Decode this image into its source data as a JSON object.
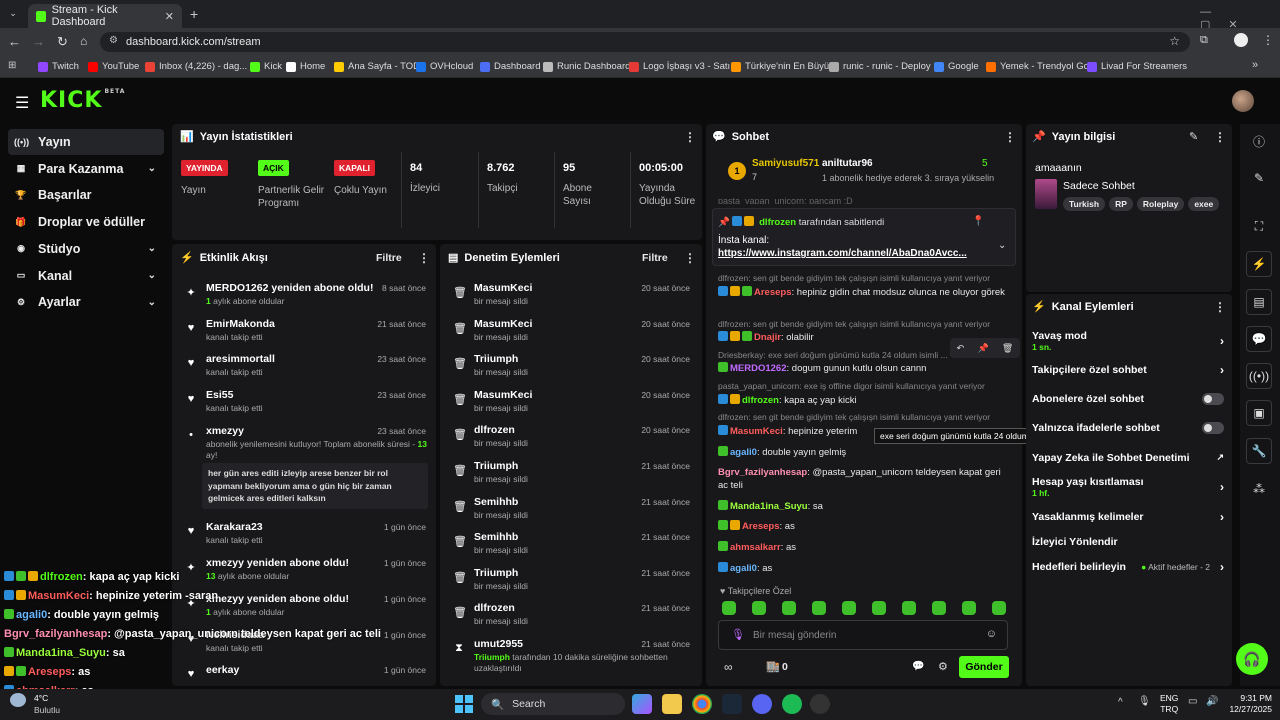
{
  "browser": {
    "tab_title": "Stream - Kick Dashboard",
    "url": "dashboard.kick.com/stream",
    "bookmarks": [
      {
        "label": "Twitch",
        "color": "#9146ff"
      },
      {
        "label": "YouTube",
        "color": "#ff0000"
      },
      {
        "label": "Inbox (4,226) - dag...",
        "color": "#ea4335"
      },
      {
        "label": "Kick",
        "color": "#53fc18"
      },
      {
        "label": "Home",
        "color": "#ffffff"
      },
      {
        "label": "Ana Sayfa - TOD",
        "color": "#ffcc00"
      },
      {
        "label": "OVHcloud",
        "color": "#1a73e8"
      },
      {
        "label": "Dashboard",
        "color": "#4c6ef5"
      },
      {
        "label": "Runic Dashboard",
        "color": "#bbbbbb"
      },
      {
        "label": "Logo İşbaşı v3 - Satı...",
        "color": "#e53935"
      },
      {
        "label": "Türkiye'nin En Büyü...",
        "color": "#ff9800"
      },
      {
        "label": "runic - runic - Deploy",
        "color": "#aaaaaa"
      },
      {
        "label": "Google",
        "color": "#4285f4"
      },
      {
        "label": "Yemek - Trendyol Go",
        "color": "#ff6f00"
      },
      {
        "label": "Livad For Streamers",
        "color": "#7c4dff"
      }
    ]
  },
  "sidebar": {
    "items": [
      {
        "label": "Yayın",
        "icon": "broadcast-icon"
      },
      {
        "label": "Para Kazanma",
        "icon": "money-icon"
      },
      {
        "label": "Başarılar",
        "icon": "trophy-icon"
      },
      {
        "label": "Droplar ve ödüller",
        "icon": "gift-icon"
      },
      {
        "label": "Stüdyo",
        "icon": "studio-icon"
      },
      {
        "label": "Kanal",
        "icon": "channel-icon"
      },
      {
        "label": "Ayarlar",
        "icon": "gear-icon"
      }
    ]
  },
  "stats": {
    "title": "Yayın İstatistikleri",
    "yayin_badge": "YAYINDA",
    "yayin_label": "Yayın",
    "partner_badge": "AÇIK",
    "partner_label": "Partnerlik Gelir Programı",
    "multi_badge": "KAPALI",
    "multi_label": "Çoklu Yayın",
    "viewers": "84",
    "viewers_label": "İzleyici",
    "followers": "8.762",
    "followers_label": "Takipçi",
    "subs": "95",
    "subs_label": "Abone Sayısı",
    "uptime": "00:05:00",
    "uptime_label": "Yayında Olduğu Süre"
  },
  "events": {
    "title": "Etkinlik Akışı",
    "filter": "Filtre",
    "items": [
      {
        "name": "MERDO1262 yeniden abone oldu!",
        "time": "8 saat önce",
        "sub_num": "1",
        "sub": " aylık abone oldular"
      },
      {
        "name": "EmirMakonda",
        "time": "21 saat önce",
        "sub": "kanalı takip etti"
      },
      {
        "name": "aresimmortall",
        "time": "23 saat önce",
        "sub": "kanalı takip etti"
      },
      {
        "name": "Esi55",
        "time": "23 saat önce",
        "sub": "kanalı takip etti"
      },
      {
        "name": "xmezyy",
        "time": "23 saat önce",
        "sub": "abonelik yenilemesini kutluyor! Toplam abonelik süresi - ",
        "sub_num": "13",
        "sub2": "ay!",
        "message": "her gün ares editi izleyip arese benzer bir rol yapmanı bekliyorum ama o gün hiç bir zaman gelmicek ares editleri kalksın"
      },
      {
        "name": "Karakara23",
        "time": "1 gün önce",
        "sub": "kanalı takip etti"
      },
      {
        "name": "xmezyy yeniden abone oldu!",
        "time": "1 gün önce",
        "sub_num": "13",
        "sub": " aylık abone oldular"
      },
      {
        "name": "xmezyy yeniden abone oldu!",
        "time": "1 gün önce",
        "sub_num": "1",
        "sub": " aylık abone oldular"
      },
      {
        "name": "Nelinsidaaa",
        "time": "1 gün önce",
        "sub": "kanalı takip etti"
      },
      {
        "name": "eerkay",
        "time": "1 gün önce",
        "sub": ""
      }
    ]
  },
  "mod": {
    "title": "Denetim Eylemleri",
    "filter": "Filtre",
    "items": [
      {
        "name": "MasumKeci",
        "time": "20 saat önce",
        "sub": "bir mesajı sildi"
      },
      {
        "name": "MasumKeci",
        "time": "20 saat önce",
        "sub": "bir mesajı sildi"
      },
      {
        "name": "Triiumph",
        "time": "20 saat önce",
        "sub": "bir mesajı sildi"
      },
      {
        "name": "MasumKeci",
        "time": "20 saat önce",
        "sub": "bir mesajı sildi"
      },
      {
        "name": "dlfrozen",
        "time": "20 saat önce",
        "sub": "bir mesajı sildi"
      },
      {
        "name": "Triiumph",
        "time": "21 saat önce",
        "sub": "bir mesajı sildi"
      },
      {
        "name": "Semihhb",
        "time": "21 saat önce",
        "sub": "bir mesajı sildi"
      },
      {
        "name": "Semihhb",
        "time": "21 saat önce",
        "sub": "bir mesajı sildi"
      },
      {
        "name": "Triiumph",
        "time": "21 saat önce",
        "sub": "bir mesajı sildi"
      },
      {
        "name": "dlfrozen",
        "time": "21 saat önce",
        "sub": "bir mesajı sildi"
      },
      {
        "name": "umut2955",
        "time": "21 saat önce",
        "sub_user": "Triiumph",
        "sub": " tarafından 10 dakika süreliğine sohbetten uzaklaştırıldı"
      }
    ]
  },
  "chat": {
    "title": "Sohbet",
    "gifter": "Samiyusuf571",
    "gift_count": "7",
    "gift_target": "aniltutar96",
    "gift_count2": "5",
    "gift_text": "1 abonelik hediye ederek 3. sıraya yükselin",
    "ghost_line": "pasta_yapan_unicorn: pancam :D",
    "pinned_by": "dlfrozen",
    "pinned_suffix": " tarafından sabitlendi",
    "pinned_label": "İnsta kanal:",
    "pinned_link": "https://www.instagram.com/channel/AbaDna0Avcc...",
    "lines": [
      {
        "reply": "dlfrozen: sen git bende gidiyim tek çalışışn isimli kullanıcıya yanıt veriyor",
        "user": "Areseps",
        "cls": "u-red",
        "text": "hepiniz gidin chat modsuz olunca ne oluyor görek"
      },
      {
        "reply": "dlfrozen: sen git bende gidiyim tek çalışışn isimli kullanıcıya yanıt veriyor",
        "user": "Dnajir",
        "cls": "u-red",
        "text": "olabilir"
      },
      {
        "reply": "Driesberkay: exe seri doğum günümü kutla 24 oldum isimli ...",
        "user": "MERDO1262",
        "cls": "u-purple",
        "text": "dogum gunun kutlu olsun cannn"
      },
      {
        "reply": "pasta_yapan_unicorn: exe iş offline digor isimli kullanıcıya yanıt veriyor",
        "user": "dlfrozen",
        "cls": "u-green",
        "text": "kapa aç yap kicki"
      },
      {
        "reply": "dlfrozen: sen git bende gidiyim tek çalışışn isimli kullanıcıya yanıt veriyor",
        "user": "MasumKeci",
        "cls": "u-red",
        "text": "hepinize yeterim"
      },
      {
        "user": "agali0",
        "cls": "u-blue",
        "text": "double yayın gelmiş"
      },
      {
        "user": "Bgrv_fazilyanhesap",
        "cls": "u-pink",
        "text": "@pasta_yapan_unicorn teldeysen kapat geri ac teli"
      },
      {
        "user": "Manda1ina_Suyu",
        "cls": "u-lime",
        "text": "sa"
      },
      {
        "user": "Areseps",
        "cls": "u-red",
        "text": "as"
      },
      {
        "user": "ahmsalkarr",
        "cls": "u-red",
        "text": "as"
      },
      {
        "user": "agali0",
        "cls": "u-blue",
        "text": "as"
      }
    ],
    "tooltip": "exe seri doğum günümü kutla 24 oldum",
    "followers_only_label": "Takipçilere Özel",
    "input_placeholder": "Bir mesaj gönderin",
    "points": "0",
    "send_label": "Gönder"
  },
  "streaminfo": {
    "title": "Yayın bilgisi",
    "stream_title": "amaaanın",
    "category": "Sadece Sohbet",
    "tags": [
      "Turkish",
      "RP",
      "Roleplay",
      "exee"
    ]
  },
  "channel_actions": {
    "title": "Kanal Eylemleri",
    "slow_mode": "Yavaş mod",
    "slow_mode_value": "1 sn.",
    "followers_chat": "Takipçilere özel sohbet",
    "subs_chat": "Abonelere özel sohbet",
    "emotes_chat": "Yalnızca ifadelerle sohbet",
    "ai_mod": "Yapay Zeka ile Sohbet Denetimi",
    "account_age": "Hesap yaşı kısıtlaması",
    "account_age_value": "1 hf.",
    "banned_words": "Yasaklanmış kelimeler",
    "viewer_redirect": "İzleyici Yönlendir",
    "goals": "Hedefleri belirleyin",
    "goals_value": "Aktif hedefler - 2"
  },
  "overlay": {
    "lines": [
      {
        "user": "dlfrozen",
        "cls": "u-green",
        "text": ": kapa aç yap kicki"
      },
      {
        "user": "MasumKeci",
        "cls": "u-red",
        "text": ": hepinize yeterim -saran"
      },
      {
        "user": "agali0",
        "cls": "u-blue",
        "text": ": double yayın gelmiş"
      },
      {
        "user": "Bgrv_fazilyanhesap",
        "cls": "u-pink",
        "text": ": @pasta_yapan_unicorn teldeysen kapat geri ac teli"
      },
      {
        "user": "Manda1ina_Suyu",
        "cls": "u-lime",
        "text": ": sa"
      },
      {
        "user": "Areseps",
        "cls": "u-red",
        "text": ": as"
      },
      {
        "user": "ahmsalkarr",
        "cls": "u-red",
        "text": ": as"
      }
    ]
  },
  "taskbar": {
    "weather_temp": "4°C",
    "weather_desc": "Bulutlu",
    "search_label": "Search",
    "lang": "ENG",
    "lang2": "TRQ",
    "time": "9:31 PM",
    "date": "12/27/2025"
  }
}
